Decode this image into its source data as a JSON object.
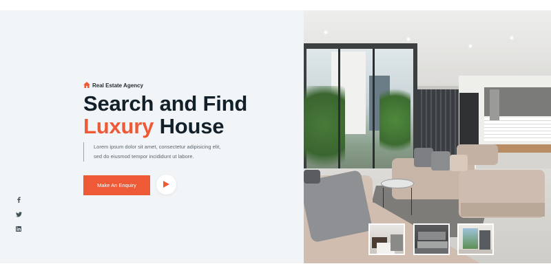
{
  "hero": {
    "tagline": "Real Estate Agency",
    "headline_line1": "Search and Find",
    "headline_accent": "Luxury",
    "headline_rest": " House",
    "description_line1": "Lorem ipsum dolor sit amet, consectetur adipisicing elit,",
    "description_line2": "sed do eiusmod tempor incididunt ut labore.",
    "cta_label": "Make An Enquiry"
  },
  "icons": {
    "tagline": "home-icon",
    "play": "play-icon",
    "social": [
      "facebook-icon",
      "twitter-icon",
      "linkedin-icon"
    ]
  },
  "gallery": {
    "thumbnails": [
      "bedroom-thumbnail",
      "living-room-thumbnail",
      "balcony-thumbnail"
    ]
  },
  "colors": {
    "accent": "#ef5a36",
    "heading": "#12202a",
    "panel_bg": "#f2f5f7"
  }
}
